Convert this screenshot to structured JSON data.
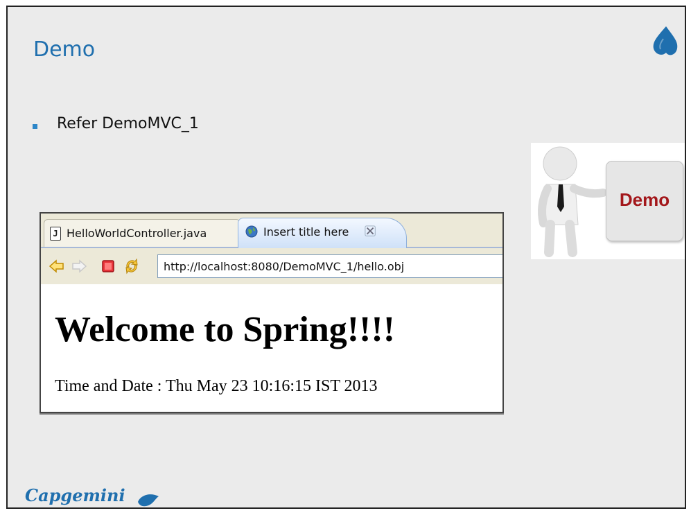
{
  "slide": {
    "title": "Demo",
    "bullet": "Refer DemoMVC_1",
    "brand": "Capgemini",
    "accent_color": "#1f6fae",
    "bullet_color": "#2c86c8"
  },
  "demo_image": {
    "word": "Demo",
    "word_color": "#a3171b"
  },
  "browser": {
    "tabs": [
      {
        "label": "HelloWorldController.java",
        "icon": "java-file-icon",
        "active": false
      },
      {
        "label": "Insert title here",
        "icon": "globe-icon",
        "active": true
      }
    ],
    "toolbar": {
      "back": "back-arrow-icon",
      "forward": "forward-arrow-icon",
      "stop": "stop-icon",
      "refresh": "refresh-icon"
    },
    "url": "http://localhost:8080/DemoMVC_1/hello.obj",
    "page": {
      "heading": "Welcome to Spring!!!!",
      "time_line": "Time and Date : Thu May 23 10:16:15 IST 2013"
    }
  }
}
